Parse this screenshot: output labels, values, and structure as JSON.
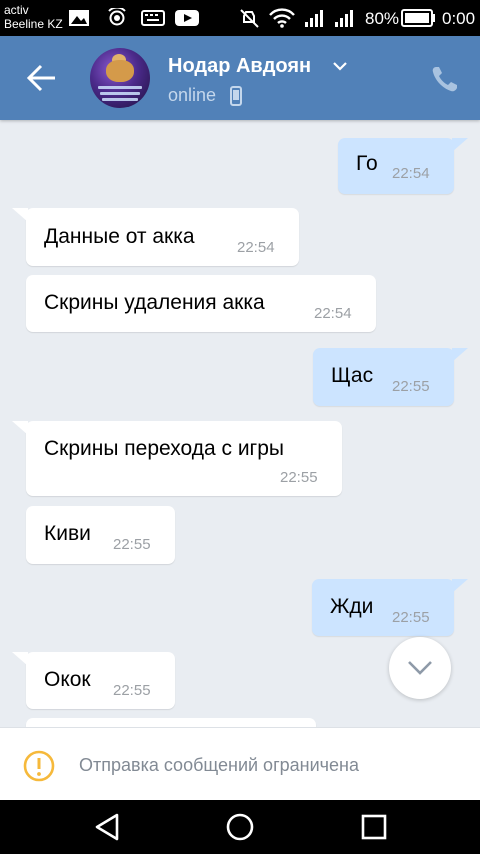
{
  "status_bar": {
    "carrier_line1": "activ",
    "carrier_line2": "Beeline KZ",
    "battery": "80%",
    "time": "0:00"
  },
  "header": {
    "contact_name": "Нодар Авдоян",
    "status": "online"
  },
  "messages": [
    {
      "direction": "out",
      "text": "Го",
      "time": "22:54"
    },
    {
      "direction": "in",
      "text": "Данные от акка",
      "time": "22:54"
    },
    {
      "direction": "in",
      "text": "Скрины удаления акка",
      "time": "22:54"
    },
    {
      "direction": "out",
      "text": "Щас",
      "time": "22:55"
    },
    {
      "direction": "in",
      "text": "Скрины перехода с игры",
      "time": "22:55"
    },
    {
      "direction": "in",
      "text": "Киви",
      "time": "22:55"
    },
    {
      "direction": "out",
      "text": "Жди",
      "time": "22:55"
    },
    {
      "direction": "in",
      "text": "Окок",
      "time": "22:55"
    }
  ],
  "restriction": {
    "text": "Отправка сообщений ограничена"
  },
  "colors": {
    "header_bg": "#5181b8",
    "chat_bg": "#e9edf2",
    "outgoing_bubble": "#cce4ff",
    "incoming_bubble": "#ffffff",
    "warning": "#f6b93b"
  }
}
